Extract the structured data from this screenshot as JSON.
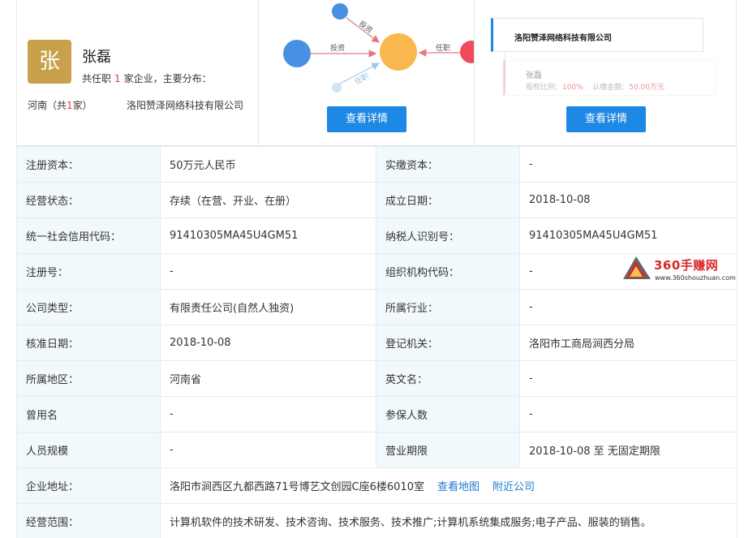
{
  "person": {
    "avatar_char": "张",
    "name": "张磊",
    "role_prefix": "共任职",
    "role_count": "1",
    "role_suffix": "家企业，主要分布：",
    "region_prefix": "河南（共",
    "region_count": "1",
    "region_suffix": "家）",
    "company": "洛阳赞泽网络科技有限公司"
  },
  "graph": {
    "edge_invest_1": "投资",
    "edge_invest_2": "投资",
    "edge_role_1": "任职",
    "edge_role_2": "任职",
    "colors": {
      "blue": "#4a90e2",
      "orange": "#f9b84d",
      "red": "#f04a5a",
      "arrow": "#e07a86"
    },
    "button": "查看详情"
  },
  "tree": {
    "company": "洛阳赞泽网络科技有限公司",
    "holder_name": "张磊",
    "holder_ratio_label": "股权比例：",
    "holder_ratio": "100%",
    "holder_amount_label": "认缴金额：",
    "holder_amount": "50.00万元",
    "button": "查看详情"
  },
  "info": {
    "registered_capital_label": "注册资本：",
    "registered_capital": "50万元人民币",
    "paid_capital_label": "实缴资本：",
    "paid_capital": "-",
    "status_label": "经营状态：",
    "status": "存续（在营、开业、在册）",
    "founded_label": "成立日期：",
    "founded": "2018-10-08",
    "credit_code_label": "统一社会信用代码：",
    "credit_code": "91410305MA45U4GM51",
    "taxpayer_label": "纳税人识别号：",
    "taxpayer": "91410305MA45U4GM51",
    "reg_no_label": "注册号：",
    "reg_no": "-",
    "org_code_label": "组织机构代码：",
    "org_code": "-",
    "company_type_label": "公司类型：",
    "company_type": "有限责任公司(自然人独资)",
    "industry_label": "所属行业：",
    "industry": "-",
    "approval_date_label": "核准日期：",
    "approval_date": "2018-10-08",
    "authority_label": "登记机关：",
    "authority": "洛阳市工商局涧西分局",
    "region_label": "所属地区：",
    "region": "河南省",
    "english_name_label": "英文名：",
    "english_name": "-",
    "former_name_label": "曾用名",
    "former_name": "-",
    "insured_label": "参保人数",
    "insured": "-",
    "staff_size_label": "人员规模",
    "staff_size": "-",
    "term_label": "营业期限",
    "term": "2018-10-08 至 无固定期限",
    "address_label": "企业地址：",
    "address": "洛阳市涧西区九都西路71号博艺文创园C座6楼6010室",
    "view_map": "查看地图",
    "nearby": "附近公司",
    "scope_label": "经营范围：",
    "scope": "计算机软件的技术研发、技术咨询、技术服务、技术推广;计算机系统集成服务;电子产品、服装的销售。"
  },
  "watermark": {
    "text": "360手赚网",
    "url": "www.360shouzhuan.com"
  }
}
